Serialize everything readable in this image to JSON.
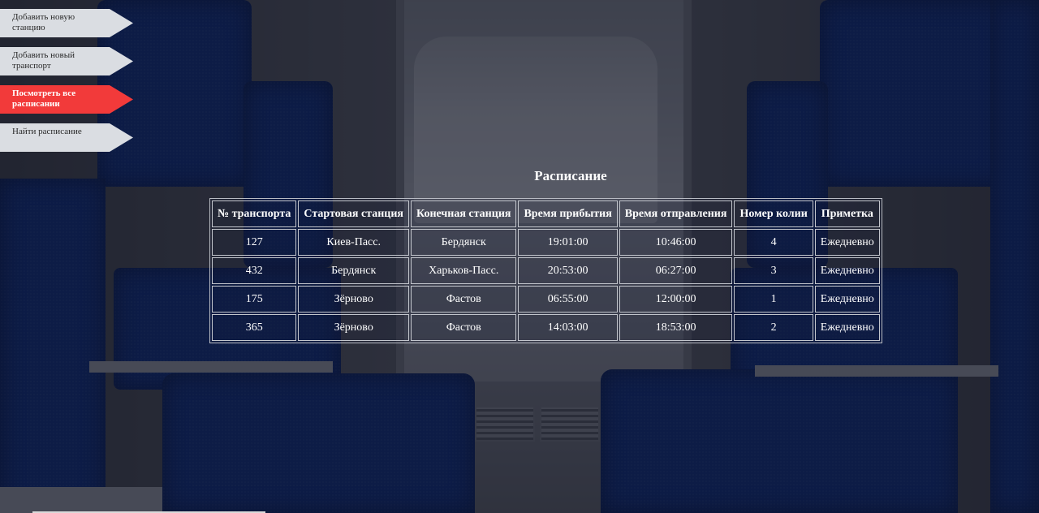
{
  "nav": {
    "items": [
      {
        "label": "Добавить новую станцию",
        "active": false
      },
      {
        "label": "Добавить новый транспорт",
        "active": false
      },
      {
        "label": "Посмотреть все расписании",
        "active": true
      },
      {
        "label": "Найти расписание",
        "active": false
      }
    ]
  },
  "schedule": {
    "title": "Расписание",
    "columns": [
      "№ транспорта",
      "Стартовая станция",
      "Конечная станция",
      "Время прибытия",
      "Время отправления",
      "Номер колии",
      "Приметка"
    ],
    "rows": [
      [
        "127",
        "Киев-Пасс.",
        "Бердянск",
        "19:01:00",
        "10:46:00",
        "4",
        "Ежедневно"
      ],
      [
        "432",
        "Бердянск",
        "Харьков-Пасс.",
        "20:53:00",
        "06:27:00",
        "3",
        "Ежедневно"
      ],
      [
        "175",
        "Зёрново",
        "Фастов",
        "06:55:00",
        "12:00:00",
        "1",
        "Ежедневно"
      ],
      [
        "365",
        "Зёрново",
        "Фастов",
        "14:03:00",
        "18:53:00",
        "2",
        "Ежедневно"
      ]
    ]
  },
  "colors": {
    "nav_active": "#f23a3a",
    "nav_inactive": "#dadde2",
    "seat_blue": "#0e2a72"
  }
}
